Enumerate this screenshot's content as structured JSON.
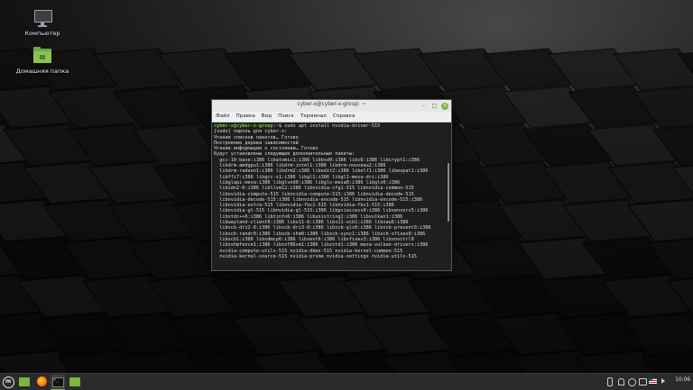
{
  "desktop": {
    "icons": [
      {
        "label": "Компьютер",
        "icon": "computer-icon"
      },
      {
        "label": "Домашняя папка",
        "icon": "home-folder-icon"
      }
    ]
  },
  "terminal": {
    "title": "cyber-x@cyber-x-group: ~",
    "menu": [
      "Файл",
      "Правка",
      "Вид",
      "Поиск",
      "Терминал",
      "Справка"
    ],
    "prompt_user": "cyber-x@cyber-x-group",
    "prompt_path": "~",
    "command": "$ sudo apt install nvidia-driver-515",
    "lines": [
      "[sudo] пароль для cyber-x:",
      "Чтение списков пакетов… Готово",
      "Построение дерева зависимостей",
      "Чтение информации о состоянии… Готово",
      "Будут установлены следующие дополнительные пакеты:",
      "  gcc-10-base:i386 libatomic1:i386 libbsd0:i386 libc6:i386 libcrypt1:i386",
      "  libdrm-amdgpu1:i386 libdrm-intel1:i386 libdrm-nouveau2:i386",
      "  libdrm-radeon1:i386 libdrm2:i386 libedit2:i386 libelf1:i386 libexpat1:i386",
      "  libffi7:i386 libgcc-s1:i386 libgl1:i386 libgl1-mesa-dri:i386",
      "  libglapi-mesa:i386 libglvnd0:i386 libglx-mesa0:i386 libglx0:i386",
      "  libidn2-0:i386 libllvm12:i386 libnvidia-cfg1-515 libnvidia-common-515",
      "  libnvidia-compute-515 libnvidia-compute-515:i386 libnvidia-decode-515",
      "  libnvidia-decode-515:i386 libnvidia-encode-515 libnvidia-encode-515:i386",
      "  libnvidia-extra-515 libnvidia-fbc1-515 libnvidia-fbc1-515:i386",
      "  libnvidia-gl-515 libnvidia-gl-515:i386 libpciaccess0:i386 libsensors5:i386",
      "  libstdc++6:i386 libtinfo6:i386 libunistring2:i386 libvulkan1:i386",
      "  libwayland-client0:i386 libx11-6:i386 libx11-xcb1:i386 libxau6:i386",
      "  libxcb-dri2-0:i386 libxcb-dri3-0:i386 libxcb-glx0:i386 libxcb-present0:i386",
      "  libxcb-randr0:i386 libxcb-shm0:i386 libxcb-sync1:i386 libxcb-xfixes0:i386",
      "  libxcb1:i386 libxdmcp6:i386 libxext6:i386 libxfixes3:i386 libxnvctrl0",
      "  libxshmfence1:i386 libxxf86vm1:i386 libzstd1:i386 mesa-vulkan-drivers:i386",
      "  nvidia-compute-utils-515 nvidia-dkms-515 nvidia-kernel-common-515",
      "  nvidia-kernel-source-515 nvidia-prime nvidia-settings nvidia-utils-515"
    ]
  },
  "panel": {
    "launchers": [
      "mint-menu-icon",
      "files-icon",
      "firefox-icon",
      "terminal-icon",
      "folder-icon"
    ],
    "tray": [
      "bluetooth-icon",
      "notification-icon",
      "update-icon",
      "display-icon",
      "keyboard-layout-icon",
      "volume-icon"
    ],
    "clock": "10:06"
  }
}
